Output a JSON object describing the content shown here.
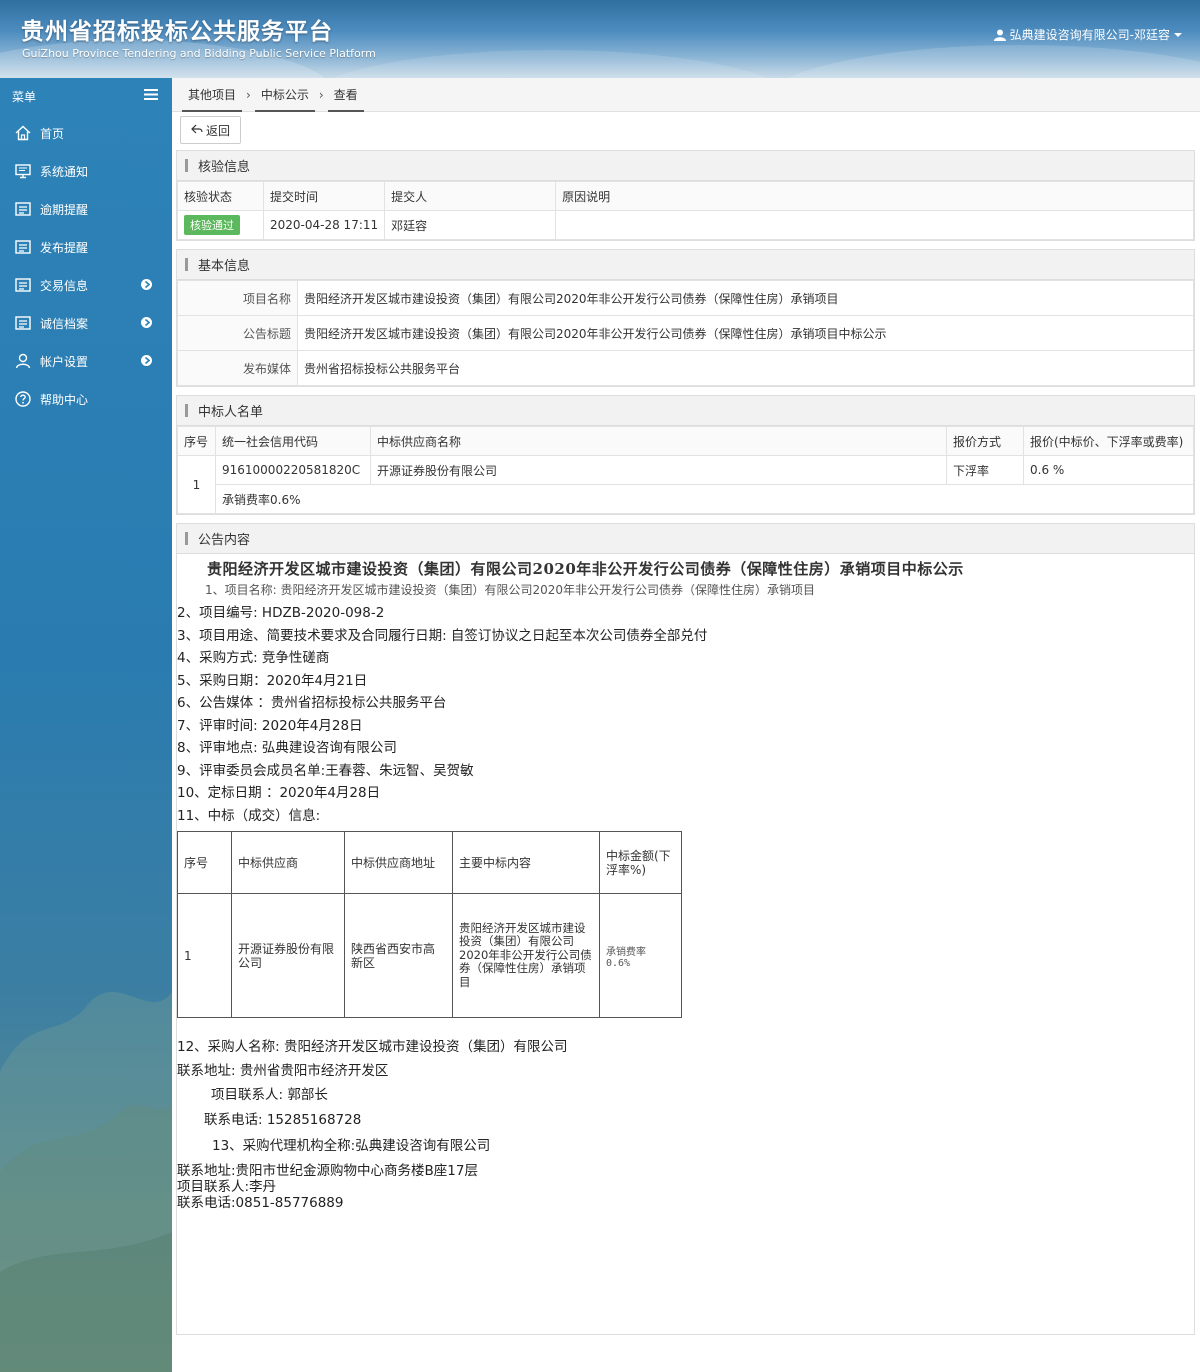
{
  "header": {
    "title_cn": "贵州省招标投标公共服务平台",
    "title_en": "GuiZhou Province Tendering and Bidding Public Service Platform",
    "user": "弘典建设咨询有限公司-邓廷容"
  },
  "sidebar": {
    "title": "菜单",
    "items": [
      {
        "label": "首页",
        "icon": "home-icon"
      },
      {
        "label": "系统通知",
        "icon": "monitor-icon"
      },
      {
        "label": "逾期提醒",
        "icon": "list-icon"
      },
      {
        "label": "发布提醒",
        "icon": "list-icon"
      },
      {
        "label": "交易信息",
        "icon": "list-icon"
      },
      {
        "label": "诚信档案",
        "icon": "list-icon"
      },
      {
        "label": "帐户设置",
        "icon": "user-icon"
      },
      {
        "label": "帮助中心",
        "icon": "help-icon"
      }
    ]
  },
  "breadcrumb": [
    "其他项目",
    "中标公示",
    "查看"
  ],
  "toolbar": {
    "back_label": "返回"
  },
  "verify": {
    "title": "核验信息",
    "headers": [
      "核验状态",
      "提交时间",
      "提交人",
      "原因说明"
    ],
    "status": "核验通过",
    "time": "2020-04-28 17:11",
    "person": "邓廷容",
    "reason": ""
  },
  "basic": {
    "title": "基本信息",
    "project_name_label": "项目名称",
    "project_name": "贵阳经济开发区城市建设投资（集团）有限公司2020年非公开发行公司债券（保障性住房）承销项目",
    "notice_title_label": "公告标题",
    "notice_title": "贵阳经济开发区城市建设投资（集团）有限公司2020年非公开发行公司债券（保障性住房）承销项目中标公示",
    "media_label": "发布媒体",
    "media": "贵州省招标投标公共服务平台"
  },
  "winners": {
    "title": "中标人名单",
    "headers": [
      "序号",
      "统一社会信用代码",
      "中标供应商名称",
      "报价方式",
      "报价(中标价、下浮率或费率)"
    ],
    "row": {
      "no": "1",
      "code": "91610000220581820C",
      "name": "开源证券股份有限公司",
      "method": "下浮率",
      "price": "0.6 %",
      "note": "承销费率0.6%"
    }
  },
  "notice": {
    "title": "公告内容",
    "heading": "贵阳经济开发区城市建设投资（集团）有限公司2020年非公开发行公司债券（保障性住房）承销项目中标公示",
    "item1": "1、项目名称: 贵阳经济开发区城市建设投资（集团）有限公司2020年非公开发行公司债券（保障性住房）承销项目",
    "item2": "2、项目编号: HDZB-2020-098-2",
    "item3": "3、项目用途、简要技术要求及合同履行日期: 自签订协议之日起至本次公司债券全部兑付",
    "item4": "4、采购方式: 竞争性磋商",
    "item5": "5、采购日期：2020年4月21日",
    "item6": "6、公告媒体 ：贵州省招标投标公共服务平台",
    "item7": "7、评审时间: 2020年4月28日",
    "item8": "8、评审地点: 弘典建设咨询有限公司",
    "item9": "9、评审委员会成员名单:王春蓉、朱远智、吴贺敏",
    "item10": "10、定标日期 ：2020年4月28日",
    "item11": "11、中标（成交）信息:",
    "award_headers": [
      "序号",
      "中标供应商",
      "中标供应商地址",
      "主要中标内容",
      "中标金额(下浮率%)"
    ],
    "award_row": {
      "no": "1",
      "supplier": "开源证券股份有限公司",
      "address": "陕西省西安市高新区",
      "content": "贵阳经济开发区城市建设投资（集团）有限公司2020年非公开发行公司债券（保障性住房）承销项目",
      "amount_1": "承销费率",
      "amount_2": "0.6%"
    },
    "item12": "12、采购人名称: 贵阳经济开发区城市建设投资（集团）有限公司",
    "buyer_addr": "联系地址: 贵州省贵阳市经济开发区",
    "buyer_contact": "项目联系人: 郭部长",
    "buyer_phone": "联系电话: 15285168728",
    "item13": "13、采购代理机构全称:弘典建设咨询有限公司",
    "agent_addr": "联系地址:贵阳市世纪金源购物中心商务楼B座17层",
    "agent_contact": "项目联系人:李丹",
    "agent_phone": "联系电话:0851-85776889"
  },
  "colors": {
    "sidebar": "#2d82b8",
    "badge": "#5cb85c"
  }
}
